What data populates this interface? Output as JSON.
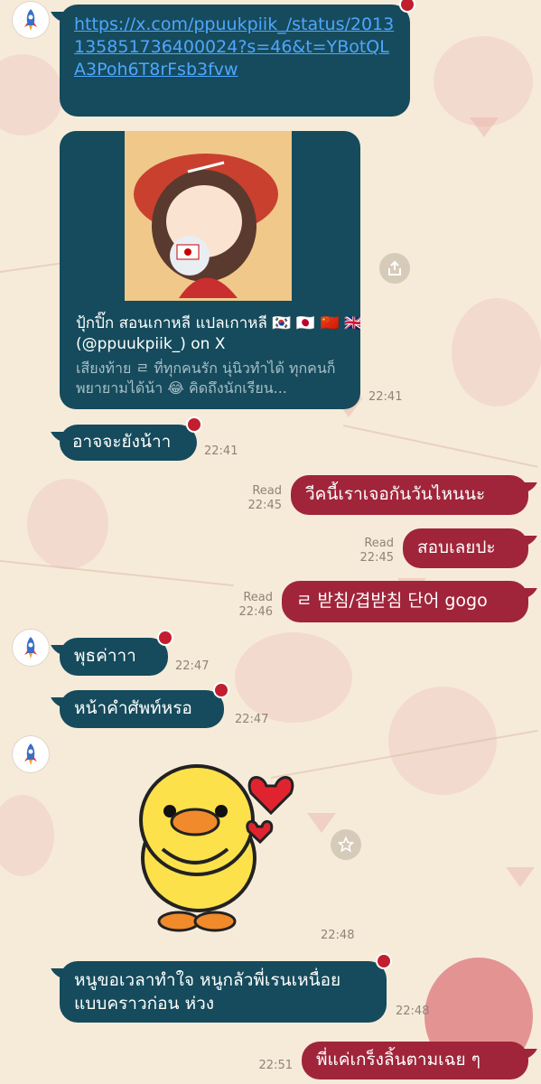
{
  "messages": {
    "m1": {
      "text": "https://x.com/ppuukpiik_/status/2013135851736400024?s=46&t=YBotQLA3Poh6T8rFsb3fvw"
    },
    "card": {
      "title": "ปุ้กปิ๊ก สอนเกาหลี แปลเกาหลี 🇰🇷 🇯🇵 🇨🇳 🇬🇧 (@ppuukpiik_) on X",
      "desc": "เสียงท้าย ㄹ ที่ทุกคนรัก นุ่นิวทำได้ ทุกคนก็พยายามได้น้า 😂 คิดถึงนักเรียน...",
      "time": "22:41"
    },
    "m2": {
      "text": "อาจจะยังน้าา",
      "time": "22:41"
    },
    "m3": {
      "text": "วีคนี้เราเจอกันวันไหนนะ",
      "read": "Read",
      "time": "22:45"
    },
    "m4": {
      "text": "สอบเลยปะ",
      "read": "Read",
      "time": "22:45"
    },
    "m5": {
      "text": "ㄹ 받침/겹받침 단어 gogo",
      "read": "Read",
      "time": "22:46"
    },
    "m6": {
      "text": "พุธค่าาา",
      "time": "22:47"
    },
    "m7": {
      "text": "หน้าคำศัพท์หรอ",
      "time": "22:47"
    },
    "sticker": {
      "time": "22:48"
    },
    "m8": {
      "text": "หนูขอเวลาทำใจ หนูกลัวพี่เรนเหนื่อยแบบคราวก่อน ห่วง",
      "time": "22:48"
    },
    "m9": {
      "text": "พี่แค่เกร็งลิ้นตามเฉย ๆ",
      "time": "22:51"
    }
  },
  "icons": {
    "avatar": "rocket-icon",
    "share": "share-icon",
    "favorite": "star-icon",
    "reaction": "heart-icon"
  },
  "colors": {
    "incoming": "#154b5c",
    "outgoing": "#a0253a",
    "link": "#4fa6ff",
    "background": "#f6ebd9"
  }
}
